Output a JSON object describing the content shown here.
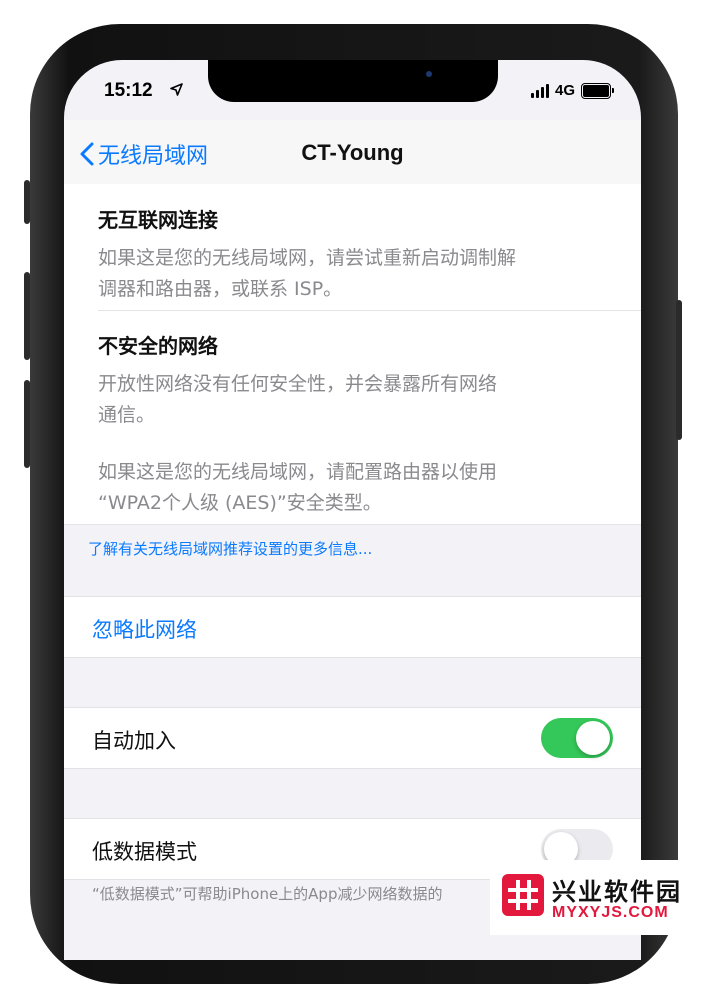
{
  "status_bar": {
    "time": "15:12",
    "network": "4G"
  },
  "navbar": {
    "back_label": "无线局域网",
    "title": "CT-Young"
  },
  "warnings": [
    {
      "title": "无互联网连接",
      "lines": [
        "如果这是您的无线局域网，请尝试重新启动调制解",
        "调器和路由器，或联系 ISP。"
      ]
    },
    {
      "title": "不安全的网络",
      "lines": [
        "开放性网络没有任何安全性，并会暴露所有网络",
        "通信。"
      ],
      "extra_lines": [
        "如果这是您的无线局域网，请配置路由器以使用",
        "“WPA2个人级 (AES)”安全类型。"
      ]
    }
  ],
  "learn_more": "了解有关无线局域网推荐设置的更多信息...",
  "forget_network": "忽略此网络",
  "auto_join": {
    "label": "自动加入",
    "on": true
  },
  "low_data": {
    "label": "低数据模式",
    "on": false
  },
  "low_data_note": "“低数据模式”可帮助iPhone上的App减少网络数据的",
  "watermark": {
    "name": "兴业软件园",
    "site": "MYXYJS.COM"
  },
  "colors": {
    "accent": "#0a7aff",
    "toggle_on": "#34c759",
    "watermark_red": "#e2183d"
  }
}
